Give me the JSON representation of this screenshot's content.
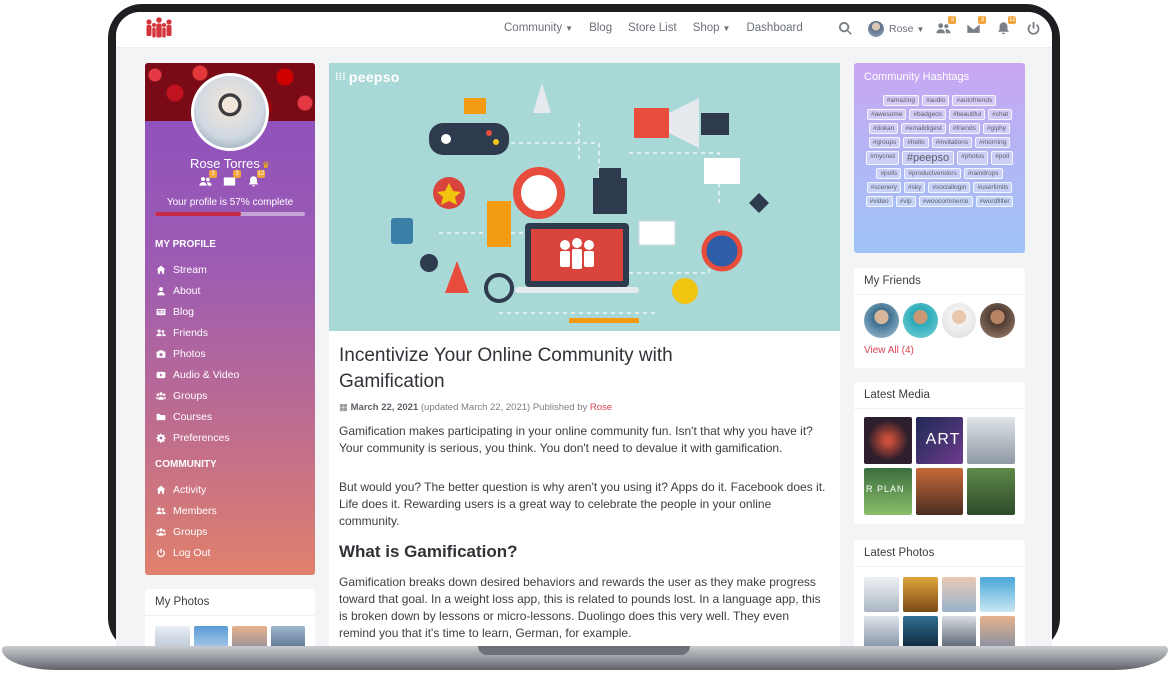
{
  "nav": {
    "items": [
      {
        "label": "Community",
        "dropdown": true
      },
      {
        "label": "Blog",
        "dropdown": false
      },
      {
        "label": "Store List",
        "dropdown": false
      },
      {
        "label": "Shop",
        "dropdown": true
      },
      {
        "label": "Dashboard",
        "dropdown": false
      }
    ],
    "user_name": "Rose",
    "badges": {
      "friends": "3",
      "messages": "3",
      "notifications": "12"
    }
  },
  "profile": {
    "name": "Rose Torres",
    "badges": {
      "friends": "3",
      "messages": "3",
      "notifications": "12"
    },
    "progress_text": "Your profile is 57% complete",
    "progress_value": 0.57,
    "my_profile_heading": "MY PROFILE",
    "my_profile_items": [
      {
        "label": "Stream",
        "icon": "home-icon"
      },
      {
        "label": "About",
        "icon": "user-icon"
      },
      {
        "label": "Blog",
        "icon": "blog-icon"
      },
      {
        "label": "Friends",
        "icon": "friends-icon"
      },
      {
        "label": "Photos",
        "icon": "camera-icon"
      },
      {
        "label": "Audio & Video",
        "icon": "video-icon"
      },
      {
        "label": "Groups",
        "icon": "groups-icon"
      },
      {
        "label": "Courses",
        "icon": "folder-icon"
      },
      {
        "label": "Preferences",
        "icon": "gear-icon"
      }
    ],
    "community_heading": "COMMUNITY",
    "community_items": [
      {
        "label": "Activity",
        "icon": "home-icon"
      },
      {
        "label": "Members",
        "icon": "friends-icon"
      },
      {
        "label": "Groups",
        "icon": "groups-icon"
      },
      {
        "label": "Log Out",
        "icon": "power-icon"
      }
    ],
    "my_photos_title": "My Photos"
  },
  "article": {
    "hero_logo": "peepso",
    "title": "Incentivize Your Online Community with Gamification",
    "date": "March 22, 2021",
    "updated": "(updated March 22, 2021) Published by",
    "author": "Rose",
    "p1": "Gamification makes participating in your online community fun. Isn't that why you have it? Your community is serious, you think. You don't need to devalue it with gamification.",
    "p2": "But would you? The better question is why aren't you using it? Apps do it. Facebook does it. Life does it. Rewarding users is a great way to celebrate the people in  your online community.",
    "h2": "What is Gamification?",
    "p3": "Gamification breaks down desired behaviors and rewards the user as they make progress toward that goal. In a weight loss app, this is related to pounds lost. In a language app, this is broken down by lessons or micro-lessons. Duolingo does this very well. They even remind you that it's time to learn, German, for example."
  },
  "hashtags": {
    "title": "Community Hashtags",
    "tags": [
      "#amazing",
      "#audio",
      "#autofriends",
      "#awesome",
      "#badgeos",
      "#beautiful",
      "#chat",
      "#dokan",
      "#emaildigest",
      "#friends",
      "#giphy",
      "#groups",
      "#hello",
      "#invitations",
      "#morning",
      "#mycred",
      "#peepso",
      "#photos",
      "#poll",
      "#polls",
      "#productvendors",
      "#raindrops",
      "#scenery",
      "#sky",
      "#sociallogin",
      "#userlimits",
      "#video",
      "#vip",
      "#woocommerce",
      "#wordfilter"
    ]
  },
  "friends": {
    "title": "My Friends",
    "view_all": "View All (4)"
  },
  "latest_media": {
    "title": "Latest Media",
    "art_text": "ART",
    "plan_text": "R PLAN"
  },
  "latest_photos": {
    "title": "Latest Photos"
  }
}
